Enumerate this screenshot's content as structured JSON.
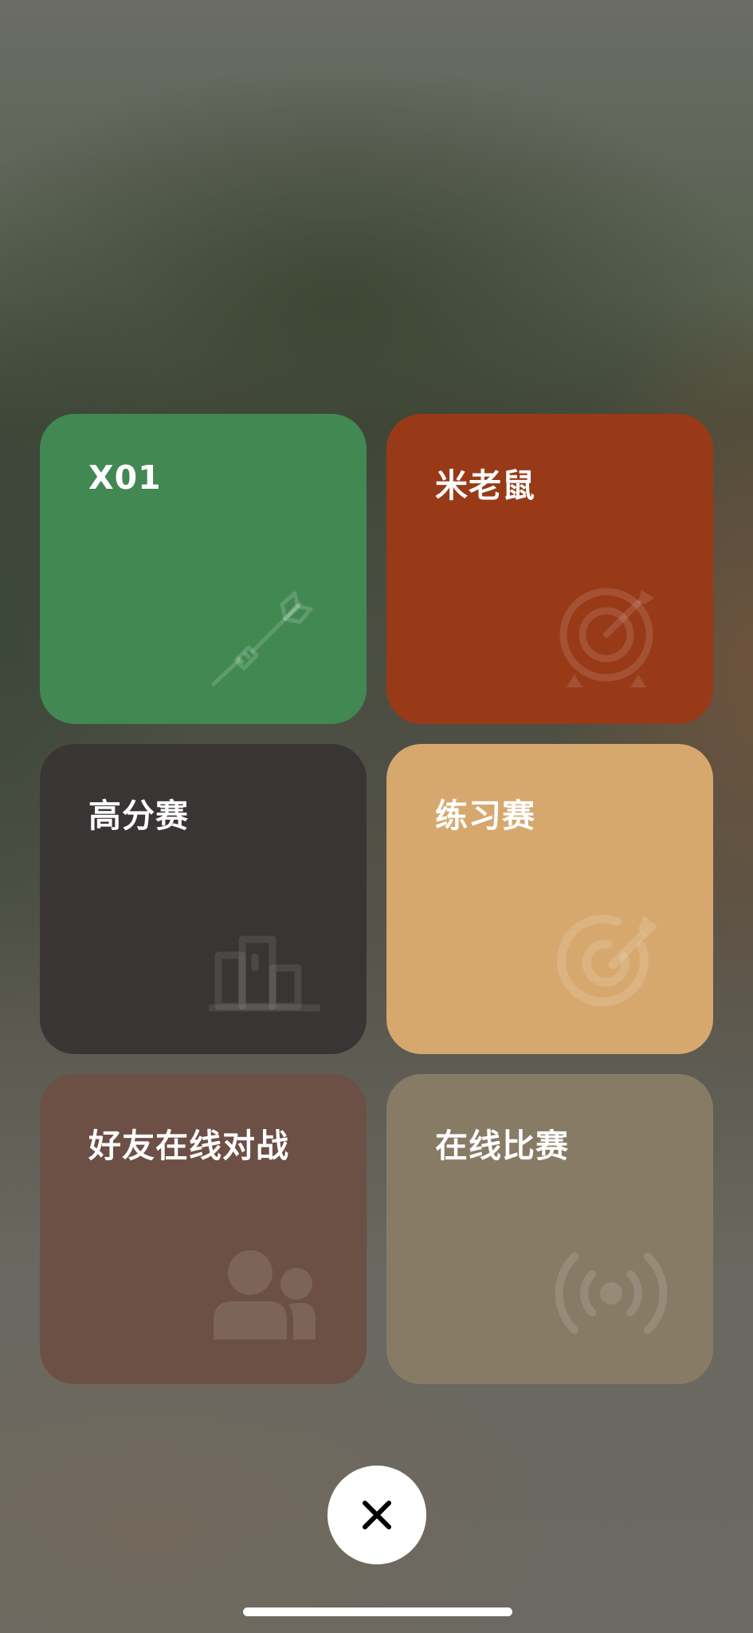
{
  "modes": [
    {
      "label": "X01",
      "icon": "dart-icon",
      "color": "#428853"
    },
    {
      "label": "米老鼠",
      "icon": "target-dart-icon",
      "color": "#983a18"
    },
    {
      "label": "高分赛",
      "icon": "podium-icon",
      "color": "#393534"
    },
    {
      "label": "练习赛",
      "icon": "bullseye-arrow-icon",
      "color": "#d6a86e"
    },
    {
      "label": "好友在线对战",
      "icon": "friends-icon",
      "color": "#6c4f45"
    },
    {
      "label": "在线比赛",
      "icon": "broadcast-icon",
      "color": "#887b66"
    }
  ],
  "close_button": {
    "icon": "close-icon"
  }
}
